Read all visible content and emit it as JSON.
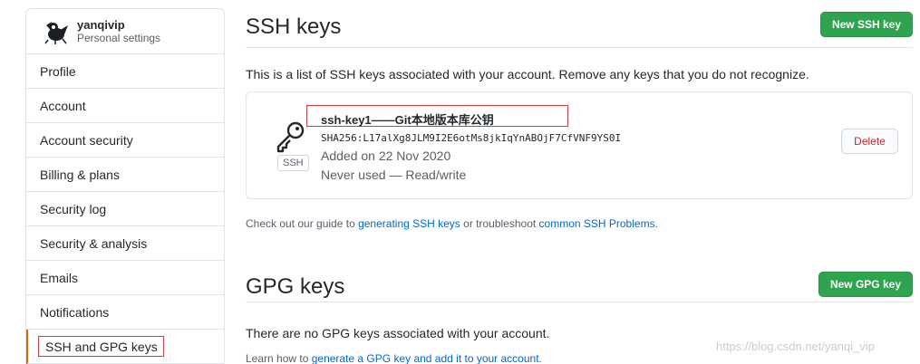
{
  "sidebar": {
    "username": "yanqivip",
    "subtitle": "Personal settings",
    "items": [
      {
        "label": "Profile"
      },
      {
        "label": "Account"
      },
      {
        "label": "Account security"
      },
      {
        "label": "Billing & plans"
      },
      {
        "label": "Security log"
      },
      {
        "label": "Security & analysis"
      },
      {
        "label": "Emails"
      },
      {
        "label": "Notifications"
      },
      {
        "label": "SSH and GPG keys"
      }
    ],
    "active_index": 8
  },
  "ssh": {
    "title": "SSH keys",
    "new_button": "New SSH key",
    "description": "This is a list of SSH keys associated with your account. Remove any keys that you do not recognize.",
    "key": {
      "title": "ssh-key1——Git本地版本库公钥",
      "fingerprint": "SHA256:L17alXg8JLM9I2E6otMs8jkIqYnABOjF7CfVNF9YS0I",
      "added": "Added on 22 Nov 2020",
      "usage": "Never used — Read/write",
      "badge": "SSH",
      "delete_button": "Delete"
    },
    "guide_prefix": "Check out our guide to ",
    "guide_link1": "generating SSH keys",
    "guide_middle": " or troubleshoot ",
    "guide_link2": "common SSH Problems",
    "guide_suffix": "."
  },
  "gpg": {
    "title": "GPG keys",
    "new_button": "New GPG key",
    "description": "There are no GPG keys associated with your account.",
    "learn_prefix": "Learn how to ",
    "learn_link": "generate a GPG key and add it to your account",
    "learn_suffix": "."
  },
  "watermark": "https://blog.csdn.net/yanqi_vip",
  "colors": {
    "accent_green": "#2ea44f",
    "link_blue": "#0366d6",
    "danger_red": "#cb2431",
    "highlight_red": "#d93a3a"
  }
}
